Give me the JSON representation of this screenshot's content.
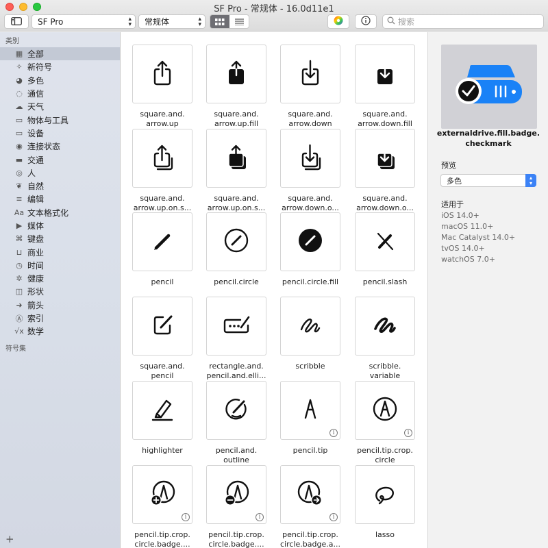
{
  "window": {
    "title": "SF Pro - 常规体 - 16.0d11e1"
  },
  "toolbar": {
    "font_popup": "SF Pro",
    "weight_popup": "常规体",
    "search_placeholder": "搜索"
  },
  "sidebar": {
    "section_categories": "类别",
    "section_sets": "符号集",
    "items": [
      {
        "icon": "grid-icon",
        "glyph": "▦",
        "label": "全部"
      },
      {
        "icon": "sparkle-icon",
        "glyph": "✧",
        "label": "新符号"
      },
      {
        "icon": "paintpalette-icon",
        "glyph": "◕",
        "label": "多色"
      },
      {
        "icon": "message-icon",
        "glyph": "◌",
        "label": "通信"
      },
      {
        "icon": "cloud-sun-icon",
        "glyph": "☁",
        "label": "天气"
      },
      {
        "icon": "folder-icon",
        "glyph": "▭",
        "label": "物体与工具"
      },
      {
        "icon": "display-icon",
        "glyph": "▭",
        "label": "设备"
      },
      {
        "icon": "antenna-icon",
        "glyph": "◉",
        "label": "连接状态"
      },
      {
        "icon": "car-icon",
        "glyph": "▬",
        "label": "交通"
      },
      {
        "icon": "person-icon",
        "glyph": "◎",
        "label": "人"
      },
      {
        "icon": "leaf-icon",
        "glyph": "❦",
        "label": "自然"
      },
      {
        "icon": "slider-icon",
        "glyph": "≡",
        "label": "编辑"
      },
      {
        "icon": "textformat-icon",
        "glyph": "Aa",
        "label": "文本格式化"
      },
      {
        "icon": "playpause-icon",
        "glyph": "▶",
        "label": "媒体"
      },
      {
        "icon": "command-icon",
        "glyph": "⌘",
        "label": "键盘"
      },
      {
        "icon": "cart-icon",
        "glyph": "⊔",
        "label": "商业"
      },
      {
        "icon": "clock-icon",
        "glyph": "◷",
        "label": "时间"
      },
      {
        "icon": "heart-icon",
        "glyph": "✲",
        "label": "健康"
      },
      {
        "icon": "square-on-circle-icon",
        "glyph": "◫",
        "label": "形状"
      },
      {
        "icon": "arrow-right-icon",
        "glyph": "➜",
        "label": "箭头"
      },
      {
        "icon": "a-circle-icon",
        "glyph": "Ⓐ",
        "label": "索引"
      },
      {
        "icon": "sqrt-icon",
        "glyph": "√x",
        "label": "数学"
      }
    ]
  },
  "grid": [
    {
      "icon": "square-and-arrow-up",
      "l1": "square.and.",
      "l2": "arrow.up",
      "info": false
    },
    {
      "icon": "square-and-arrow-up-fill",
      "l1": "square.and.",
      "l2": "arrow.up.fill",
      "info": false
    },
    {
      "icon": "square-and-arrow-down",
      "l1": "square.and.",
      "l2": "arrow.down",
      "info": false
    },
    {
      "icon": "square-and-arrow-down-fill",
      "l1": "square.and.",
      "l2": "arrow.down.fill",
      "info": false
    },
    {
      "icon": "square-and-arrow-up-on-square",
      "l1": "square.and.",
      "l2": "arrow.up.on.s...",
      "info": false
    },
    {
      "icon": "square-and-arrow-up-on-square-fill",
      "l1": "square.and.",
      "l2": "arrow.up.on.s...",
      "info": false
    },
    {
      "icon": "square-and-arrow-down-on-square",
      "l1": "square.and.",
      "l2": "arrow.down.o...",
      "info": false
    },
    {
      "icon": "square-and-arrow-down-on-square-fill",
      "l1": "square.and.",
      "l2": "arrow.down.o...",
      "info": false
    },
    {
      "icon": "pencil",
      "l1": "pencil",
      "l2": "",
      "info": false
    },
    {
      "icon": "pencil-circle",
      "l1": "pencil.circle",
      "l2": "",
      "info": false
    },
    {
      "icon": "pencil-circle-fill",
      "l1": "pencil.circle.fill",
      "l2": "",
      "info": false
    },
    {
      "icon": "pencil-slash",
      "l1": "pencil.slash",
      "l2": "",
      "info": false
    },
    {
      "icon": "square-and-pencil",
      "l1": "square.and.",
      "l2": "pencil",
      "info": false
    },
    {
      "icon": "rectangle-and-pencil-and-ellipsis",
      "l1": "rectangle.and.",
      "l2": "pencil.and.elli...",
      "info": false
    },
    {
      "icon": "scribble",
      "l1": "scribble",
      "l2": "",
      "info": false
    },
    {
      "icon": "scribble-variable",
      "l1": "scribble.",
      "l2": "variable",
      "info": false
    },
    {
      "icon": "highlighter",
      "l1": "highlighter",
      "l2": "",
      "info": false
    },
    {
      "icon": "pencil-and-outline",
      "l1": "pencil.and.",
      "l2": "outline",
      "info": false
    },
    {
      "icon": "pencil-tip",
      "l1": "pencil.tip",
      "l2": "",
      "info": true
    },
    {
      "icon": "pencil-tip-crop-circle",
      "l1": "pencil.tip.crop.",
      "l2": "circle",
      "info": true
    },
    {
      "icon": "pencil-tip-crop-circle-badge-plus",
      "l1": "pencil.tip.crop.",
      "l2": "circle.badge....",
      "info": true
    },
    {
      "icon": "pencil-tip-crop-circle-badge-minus",
      "l1": "pencil.tip.crop.",
      "l2": "circle.badge....",
      "info": true
    },
    {
      "icon": "pencil-tip-crop-circle-badge-arrow",
      "l1": "pencil.tip.crop.",
      "l2": "circle.badge.a...",
      "info": true
    },
    {
      "icon": "lasso",
      "l1": "lasso",
      "l2": "",
      "info": false
    }
  ],
  "inspector": {
    "symbol_name_l1": "externaldrive.fill.badge.",
    "symbol_name_l2": "checkmark",
    "preview_label": "预览",
    "rendering_mode": "多色",
    "availability_label": "适用于",
    "platforms": [
      "iOS 14.0+",
      "macOS 11.0+",
      "Mac Catalyst 14.0+",
      "tvOS 14.0+",
      "watchOS 7.0+"
    ],
    "accent_color": "#1a82f7"
  }
}
